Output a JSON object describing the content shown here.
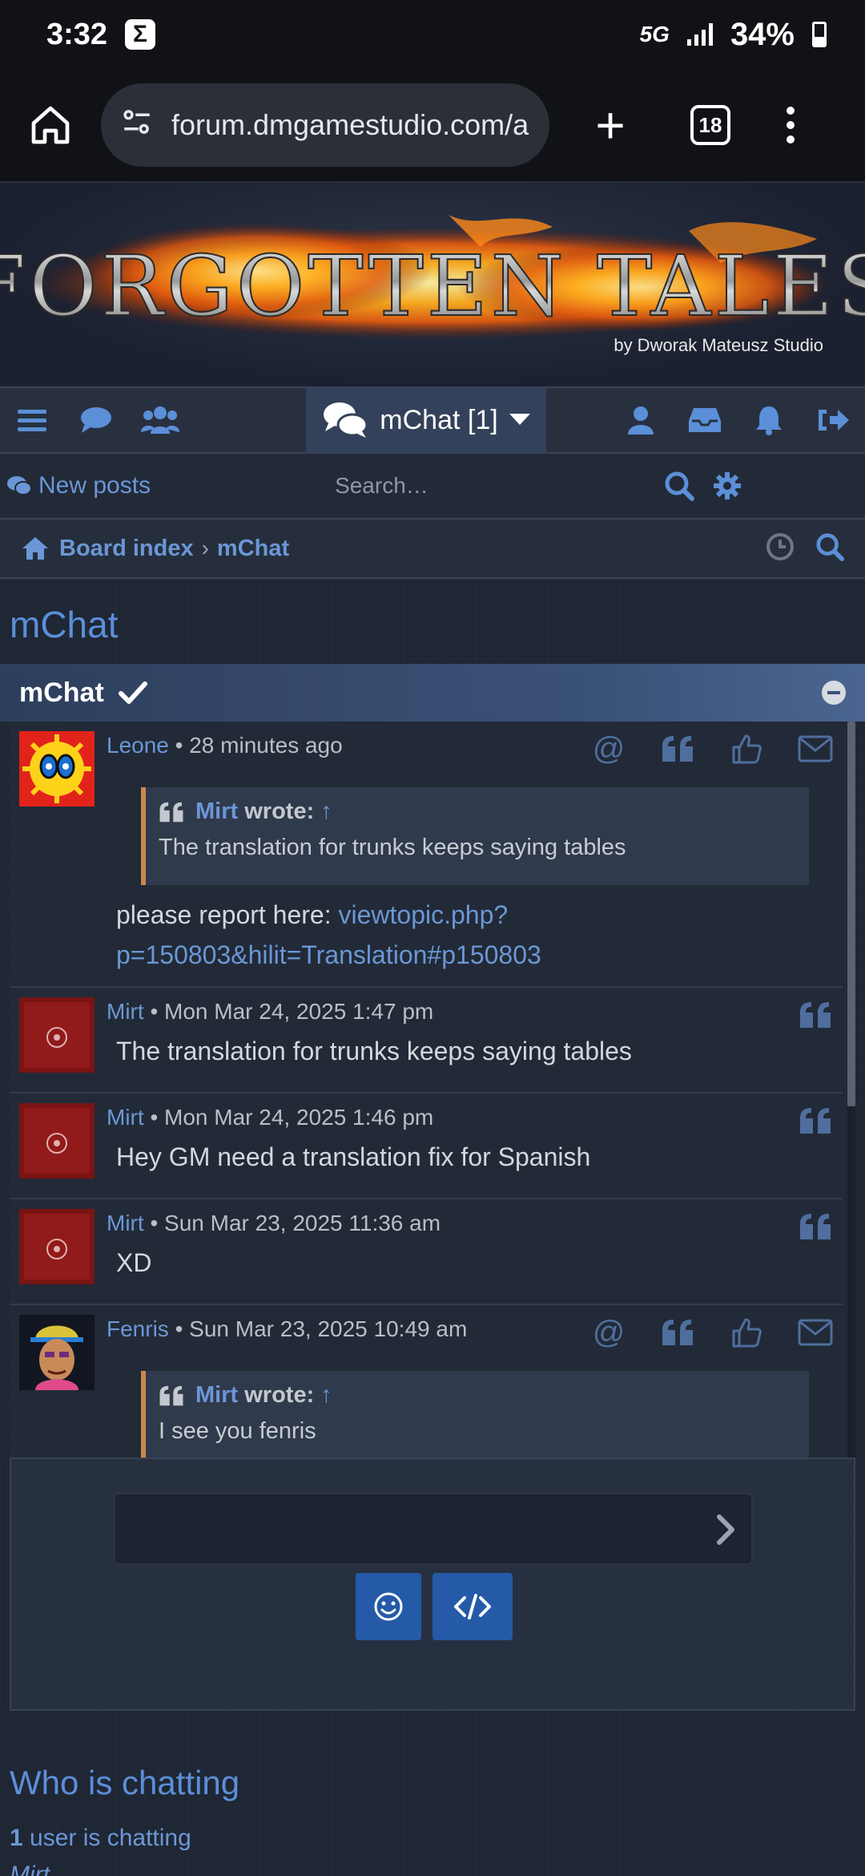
{
  "status_bar": {
    "time": "3:32",
    "notification_icon": "Σ",
    "network": "5G",
    "battery": "34%"
  },
  "browser": {
    "url": "forum.dmgamestudio.com/ap|",
    "tab_count": "18"
  },
  "banner": {
    "title": "FORGOTTEN TALES",
    "subtitle": "by Dworak Mateusz Studio"
  },
  "navbar": {
    "mchat_label": "mChat [1]"
  },
  "subnav": {
    "new_posts": "New posts",
    "search_placeholder": "Search…"
  },
  "breadcrumb": {
    "items": [
      "Board index",
      "mChat"
    ]
  },
  "page": {
    "title": "mChat",
    "panel_title": "mChat"
  },
  "messages": [
    {
      "user": "Leone",
      "time": "• 28 minutes ago",
      "quote_author": "Mirt",
      "quote_wrote": "wrote:",
      "quote_arrow": "↑",
      "quote_text": "The translation for trunks keeps saying tables",
      "text_prefix": "please report here: ",
      "link_line1": "viewtopic.php?",
      "link_line2": "p=150803&hilit=Translation#p150803"
    },
    {
      "user": "Mirt",
      "time": "• Mon Mar 24, 2025 1:47 pm",
      "text": "The translation for trunks keeps saying tables"
    },
    {
      "user": "Mirt",
      "time": "• Mon Mar 24, 2025 1:46 pm",
      "text": "Hey GM need a translation fix for Spanish"
    },
    {
      "user": "Mirt",
      "time": "• Sun Mar 23, 2025 11:36 am",
      "text": "XD"
    },
    {
      "user": "Fenris",
      "time": "• Sun Mar 23, 2025 10:49 am",
      "quote_author": "Mirt",
      "quote_wrote": "wrote:",
      "quote_arrow": "↑",
      "quote_text": "I see you fenris"
    }
  ],
  "who": {
    "title": "Who is chatting",
    "count": "1",
    "count_suffix": " user is chatting",
    "users": [
      "Mirt"
    ]
  },
  "colors": {
    "accent": "#6b97d6",
    "header_bg": "#283040",
    "quote_border": "#c98a4b",
    "button": "#245aa8"
  }
}
